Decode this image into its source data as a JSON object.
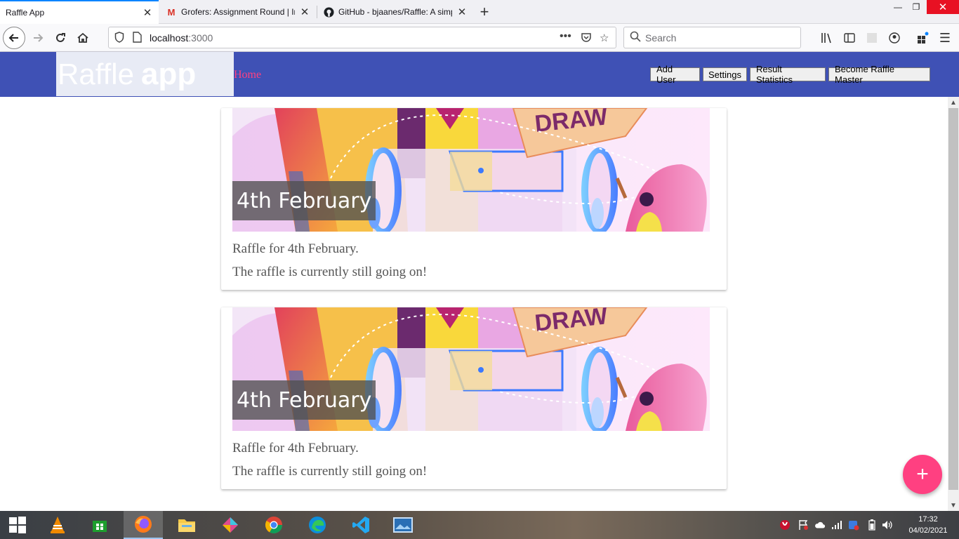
{
  "browser": {
    "tabs": [
      {
        "title": "Raffle App",
        "active": true
      },
      {
        "title": "Grofers: Assignment Round | In",
        "active": false
      },
      {
        "title": "GitHub - bjaanes/Raffle: A simp",
        "active": false
      }
    ],
    "url_host": "localhost",
    "url_port": ":3000",
    "search_placeholder": "Search"
  },
  "app": {
    "logo_thin": "Raffle",
    "logo_bold": "app",
    "home_link": "Home",
    "buttons": {
      "add_user": "Add User",
      "settings": "Settings",
      "result_statistics": "Result Statistics",
      "become_master": "Become Raffle Master"
    },
    "fab_label": "+",
    "raffles": [
      {
        "title": "4th February",
        "description": "Raffle for 4th February.",
        "status": "The raffle is currently still going on!",
        "banner_text": "DRAW"
      },
      {
        "title": "4th February",
        "description": "Raffle for 4th February.",
        "status": "The raffle is currently still going on!",
        "banner_text": "DRAW"
      }
    ]
  },
  "taskbar": {
    "time": "17:32",
    "date": "04/02/2021"
  },
  "colors": {
    "primary": "#3f51b5",
    "accent": "#ff4081"
  }
}
